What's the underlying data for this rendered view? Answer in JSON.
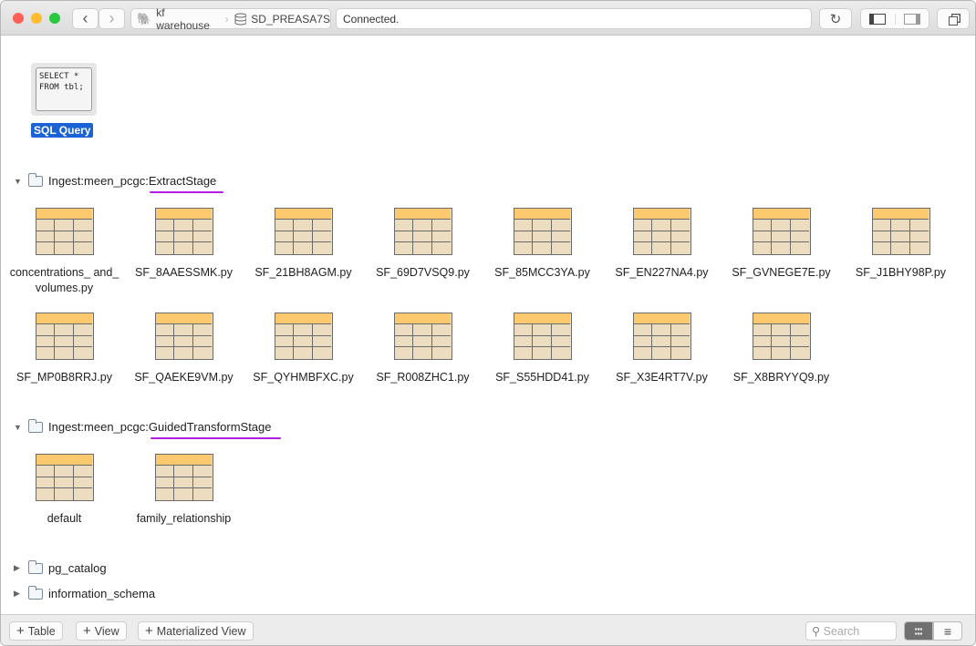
{
  "toolbar": {
    "back": "‹",
    "forward": "›",
    "connection": "kf warehouse",
    "database": "SD_PREASA7S",
    "status": "Connected.",
    "reload": "↻"
  },
  "sql_query": {
    "preview": "SELECT *\nFROM tbl;",
    "label": "SQL Query"
  },
  "schemas": [
    {
      "name_prefix": "Ingest:meen_pcgc:",
      "name_suffix": "ExtractStage",
      "expanded": true,
      "tables": [
        "concentrations_ and_volumes.py",
        "SF_8AAESSMK.py",
        "SF_21BH8AGM.py",
        "SF_69D7VSQ9.py",
        "SF_85MCC3YA.py",
        "SF_EN227NA4.py",
        "SF_GVNEGE7E.py",
        "SF_J1BHY98P.py",
        "SF_MP0B8RRJ.py",
        "SF_QAEKE9VM.py",
        "SF_QYHMBFXC.py",
        "SF_R008ZHC1.py",
        "SF_S55HDD41.py",
        "SF_X3E4RT7V.py",
        "SF_X8BRYYQ9.py"
      ]
    },
    {
      "name_prefix": "Ingest:meen_pcgc:",
      "name_suffix": "GuidedTransformStage",
      "expanded": true,
      "tables": [
        "default",
        "family_relationship"
      ]
    },
    {
      "name_prefix": "pg_catalog",
      "name_suffix": "",
      "expanded": false,
      "tables": []
    },
    {
      "name_prefix": "information_schema",
      "name_suffix": "",
      "expanded": false,
      "tables": []
    }
  ],
  "bottom": {
    "add_table": "Table",
    "add_view": "View",
    "add_matview": "Materialized View",
    "search_placeholder": "Search",
    "view_mode": "grid"
  },
  "colors": {
    "selection": "#1a62d6",
    "annotation_underline": "#b01ee0",
    "table_header": "#fdc96e",
    "table_body": "#ecdcc0"
  }
}
